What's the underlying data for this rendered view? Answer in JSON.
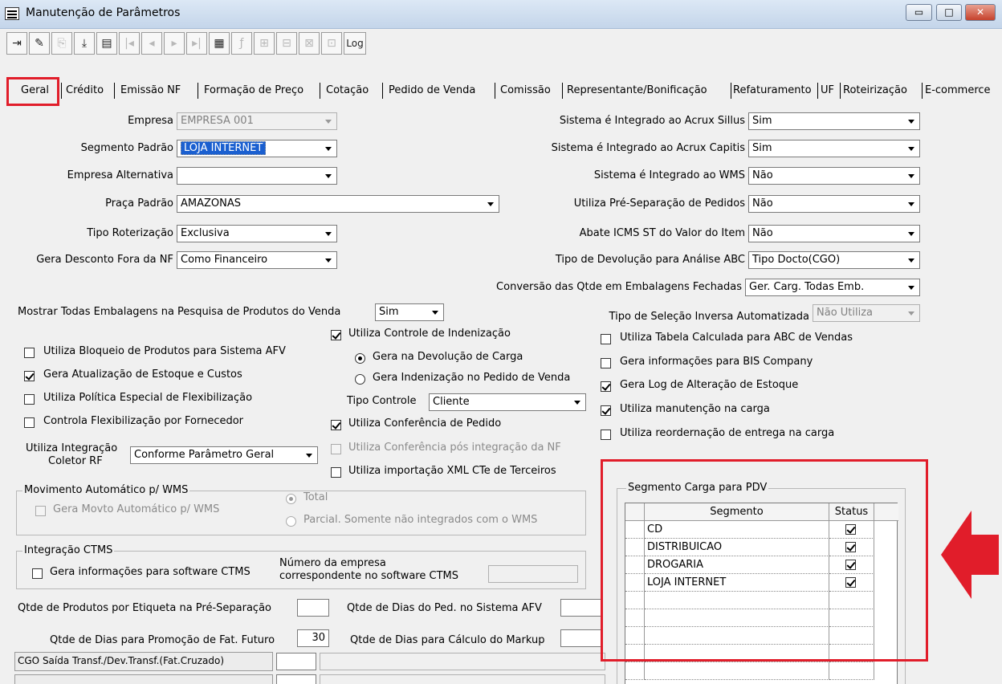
{
  "window": {
    "title": "Manutenção de Parâmetros",
    "buttons": {
      "minimize": "▭",
      "maximize": "□",
      "close": "✕"
    }
  },
  "toolbar": {
    "log_label": "Log"
  },
  "tabs": [
    "Geral",
    "Crédito",
    "Emissão NF",
    "Formação de Preço",
    "Cotação",
    "Pedido de Venda",
    "Comissão",
    "Representante/Bonificação",
    "Refaturamento",
    "UF",
    "Roteirização",
    "E-commerce"
  ],
  "left_fields": {
    "empresa": {
      "label": "Empresa",
      "value": "EMPRESA 001"
    },
    "segmento": {
      "label": "Segmento Padrão",
      "value": "LOJA INTERNET"
    },
    "empresa_alt": {
      "label": "Empresa Alternativa",
      "value": ""
    },
    "praca": {
      "label": "Praça Padrão",
      "value": "AMAZONAS"
    },
    "tipo_rot": {
      "label": "Tipo Roterização",
      "value": "Exclusiva"
    },
    "gera_desc": {
      "label": "Gera Desconto Fora da NF",
      "value": "Como Financeiro"
    },
    "mostrar_emb": {
      "label": "Mostrar Todas Embalagens na Pesquisa de Produtos do Venda",
      "value": "Sim"
    }
  },
  "right_fields": {
    "acrux_sillus": {
      "label": "Sistema é Integrado ao Acrux Sillus",
      "value": "Sim"
    },
    "acrux_capitis": {
      "label": "Sistema é Integrado ao Acrux Capitis",
      "value": "Sim"
    },
    "wms": {
      "label": "Sistema é Integrado ao WMS",
      "value": "Não"
    },
    "pre_sep": {
      "label": "Utiliza Pré-Separação de Pedidos",
      "value": "Não"
    },
    "abate_icms": {
      "label": "Abate ICMS ST do Valor do Item",
      "value": "Não"
    },
    "tipo_dev": {
      "label": "Tipo de Devolução para Análise ABC",
      "value": "Tipo Docto(CGO)"
    },
    "conversao": {
      "label": "Conversão das Qtde em Embalagens Fechadas",
      "value": "Ger. Carg. Todas Emb."
    },
    "tipo_selecao": {
      "label": "Tipo de Seleção Inversa Automatizada",
      "value": "Não Utiliza"
    }
  },
  "checks_left": [
    "Utiliza Bloqueio de Produtos para Sistema AFV",
    "Gera Atualização de Estoque e Custos",
    "Utiliza Política Especial de Flexibilização",
    "Controla Flexibilização por Fornecedor"
  ],
  "coletor": {
    "label1": "Utiliza Integração",
    "label2": "Coletor RF",
    "value": "Conforme Parâmetro Geral"
  },
  "middle": {
    "controle_indenizacao": "Utiliza Controle de Indenização",
    "radio1": "Gera na Devolução de Carga",
    "radio2": "Gera Indenização no Pedido de Venda",
    "tipo_controle_label": "Tipo Controle",
    "tipo_controle_value": "Cliente",
    "conf_pedido": "Utiliza Conferência de Pedido",
    "conf_pos": "Utiliza Conferência pós integração da NF",
    "xml_cte": "Utiliza importação XML CTe de Terceiros"
  },
  "checks_right": [
    "Utiliza Tabela Calculada para ABC de Vendas",
    "Gera informações para BIS Company",
    "Gera Log de Alteração de Estoque",
    "Utiliza manutenção na carga",
    "Utiliza reordernação de entrega na carga"
  ],
  "wms_group": {
    "title": "Movimento Automático p/ WMS",
    "check": "Gera Movto Automático p/ WMS",
    "radio_total": "Total",
    "radio_parcial": "Parcial. Somente não integrados com o WMS"
  },
  "ctms_group": {
    "title": "Integração CTMS",
    "check": "Gera informações para software CTMS",
    "num1": "Número da empresa",
    "num2": "correspondente no software CTMS"
  },
  "bottom": {
    "qtde_etiqueta": "Qtde de Produtos por Etiqueta na Pré-Separação",
    "qtde_dias_afv": "Qtde de Dias do Ped. no Sistema AFV",
    "qtde_dias_promo": "Qtde de Dias para Promoção de Fat. Futuro",
    "qtde_dias_promo_value": "30",
    "qtde_dias_markup": "Qtde de Dias para Cálculo do Markup",
    "cgo_saida": "CGO Saída Transf./Dev.Transf.(Fat.Cruzado)"
  },
  "pdv_group": {
    "title": "Segmento Carga para PDV",
    "col_segmento": "Segmento",
    "col_status": "Status",
    "rows": [
      "CD",
      "DISTRIBUICAO",
      "DROGARIA",
      "LOJA INTERNET"
    ]
  },
  "colors": {
    "highlight": "#e11d2a",
    "selection": "#1a5fd0"
  }
}
